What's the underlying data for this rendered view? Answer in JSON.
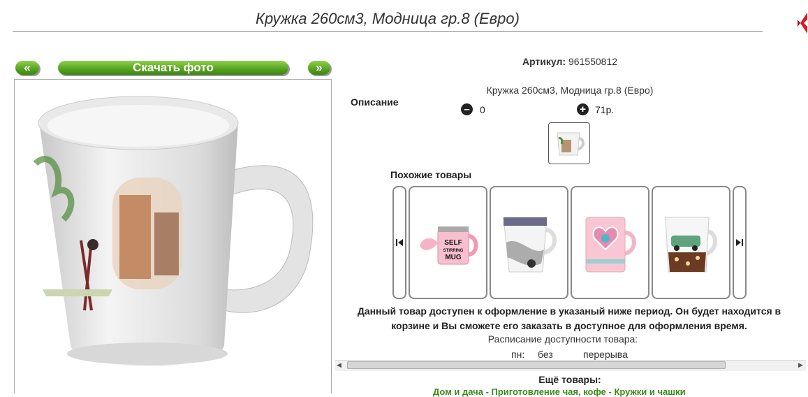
{
  "product": {
    "title": "Кружка 260см3, Модница гр.8 (Евро)",
    "article_label": "Артикул:",
    "article_value": "961550812",
    "description_label": "Описание",
    "description_text": "Кружка 260см3, Модница гр.8 (Евро)",
    "quantity": "0",
    "price": "71р."
  },
  "photo_nav": {
    "prev_label": "«",
    "download_label": "Скачать фото",
    "next_label": "»"
  },
  "similar": {
    "title": "Похожие товары",
    "cards": [
      {
        "name": "self-stirring-mug",
        "text": "SELF STIRRING MUG"
      },
      {
        "name": "fashion-mug"
      },
      {
        "name": "heart-mug"
      },
      {
        "name": "car-mug"
      }
    ]
  },
  "availability": {
    "notice_line1": "Данный товар доступен к оформление в указаный ниже период. Он будет находится в",
    "notice_line2": "корзине и Вы сможете его заказать в доступное для оформления время.",
    "schedule_title": "Расписание доступности товара:",
    "day": "пн:",
    "from": "без",
    "to": "перерыва"
  },
  "more": {
    "title": "Ещё товары:",
    "categories": "Дом и дача - Приготовление чая, кофе - Кружки и чашки"
  },
  "colors": {
    "accent_green": "#4d9a1b",
    "link_green": "#3a8a1a",
    "red": "#d71920"
  },
  "icons": [
    "minus-circle-icon",
    "plus-circle-icon",
    "first-arrow-icon",
    "last-arrow-icon",
    "diamond-icon"
  ]
}
